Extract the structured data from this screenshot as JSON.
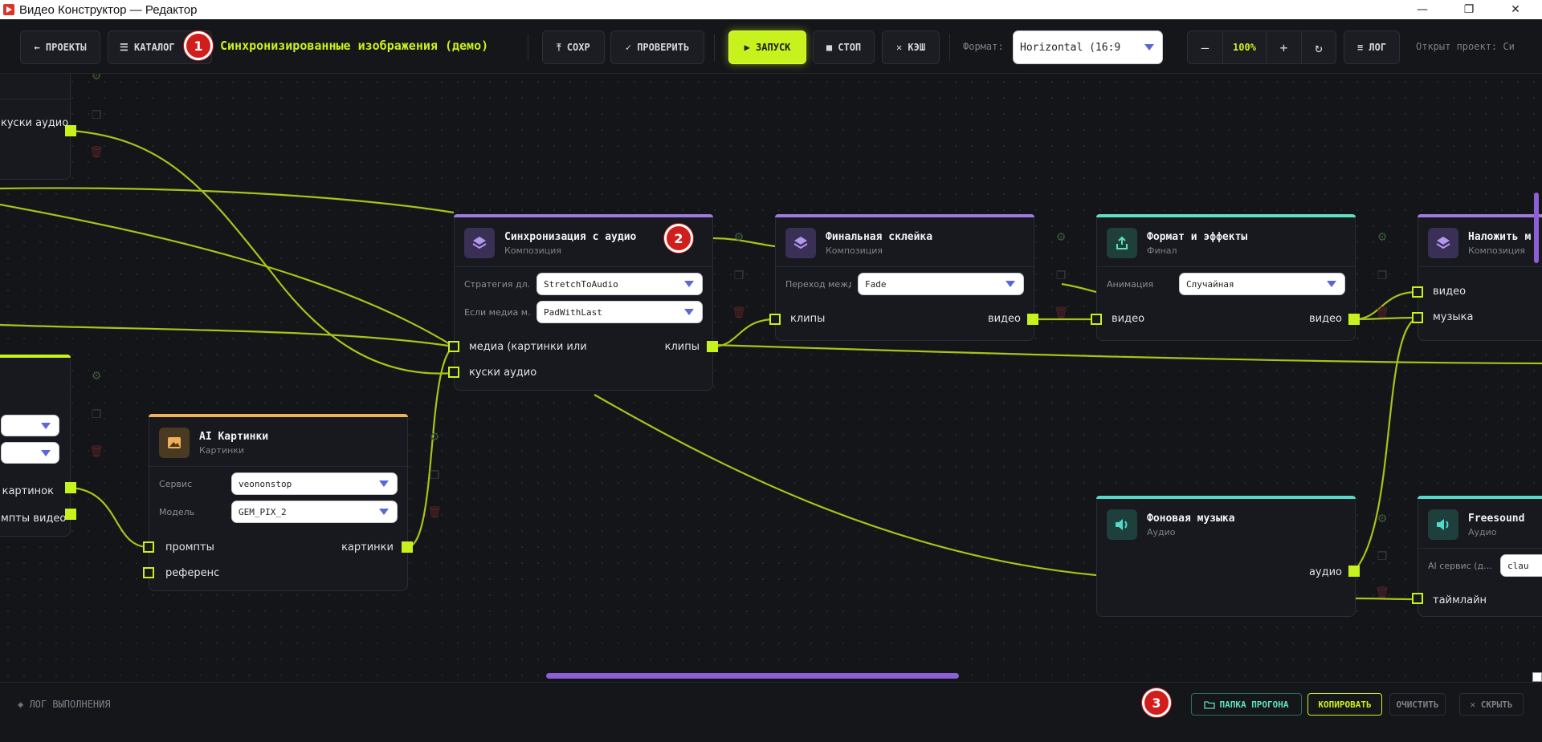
{
  "window": {
    "title": "Видео Конструктор — Редактор",
    "controls": [
      "—",
      "❐",
      "✕"
    ]
  },
  "toolbar": {
    "projects_label": "← ПРОЕКТЫ",
    "catalog_label": "☰ КАТАЛОГ",
    "project_title": "Синхронизированные изображения (демо)",
    "save_label": "⤒ СОХР",
    "check_label": "✓ ПРОВЕРИТЬ",
    "run_label": "▶ ЗАПУСК",
    "stop_label": "■ СТОП",
    "cache_label": "✕ КЭШ",
    "format_label": "Формат:",
    "format_value": "Horizontal (16:9",
    "zoom_minus": "—",
    "zoom_value": "100%",
    "zoom_plus": "+",
    "zoom_reset": "↻",
    "log_label": "≡ ЛОГ",
    "open_project": "Открыт проект: Си"
  },
  "markers": [
    "1",
    "2",
    "3"
  ],
  "nodes": {
    "left_top": {
      "out_port": "куски аудио"
    },
    "left_mid": {
      "out_port1": "картинок",
      "out_port2": "мпты видео"
    },
    "ai_images": {
      "title": "AI Картинки",
      "subtitle": "Картинки",
      "param1_label": "Сервис",
      "param1_value": "veononstop",
      "param2_label": "Модель",
      "param2_value": "GEM_PIX_2",
      "in1": "промпты",
      "in2": "референс",
      "out1": "картинки"
    },
    "sync": {
      "title": "Синхронизация с аудио",
      "subtitle": "Композиция",
      "param1_label": "Стратегия дл…",
      "param1_value": "StretchToAudio",
      "param2_label": "Если медиа м…",
      "param2_value": "PadWithLast",
      "in1": "медиа (картинки или",
      "in2": "куски аудио",
      "out1": "клипы"
    },
    "final": {
      "title": "Финальная склейка",
      "subtitle": "Композиция",
      "param1_label": "Переход межд…",
      "param1_value": "Fade",
      "in1": "клипы",
      "out1": "видео"
    },
    "format": {
      "title": "Формат и эффекты",
      "subtitle": "Финал",
      "param1_label": "Анимация",
      "param1_value": "Случайная",
      "in1": "видео",
      "out1": "видео"
    },
    "overlay": {
      "title": "Наложить м",
      "subtitle": "Композиция",
      "in1": "видео",
      "in2": "музыка"
    },
    "music": {
      "title": "Фоновая музыка",
      "subtitle": "Аудио",
      "out1": "аудио"
    },
    "freesound": {
      "title": "Freesound",
      "subtitle": "Аудио",
      "param1_label": "AI сервис (д…",
      "param1_value": "clau",
      "in1": "таймлайн"
    }
  },
  "bottombar": {
    "log_title": "◈ ЛОГ ВЫПОЛНЕНИЯ",
    "folder_label": "ПАПКА ПРОГОНА",
    "copy_label": "КОПИРОВАТЬ",
    "clear_label": "ОЧИСТИТЬ",
    "hide_label": "✕ СКРЫТЬ"
  },
  "colors": {
    "accent": "#c8f21e",
    "composition": "#9d7ce0",
    "final": "#5fe0c0",
    "images": "#f0b05a",
    "audio": "#54d8c8",
    "marker": "#d21d1d"
  }
}
